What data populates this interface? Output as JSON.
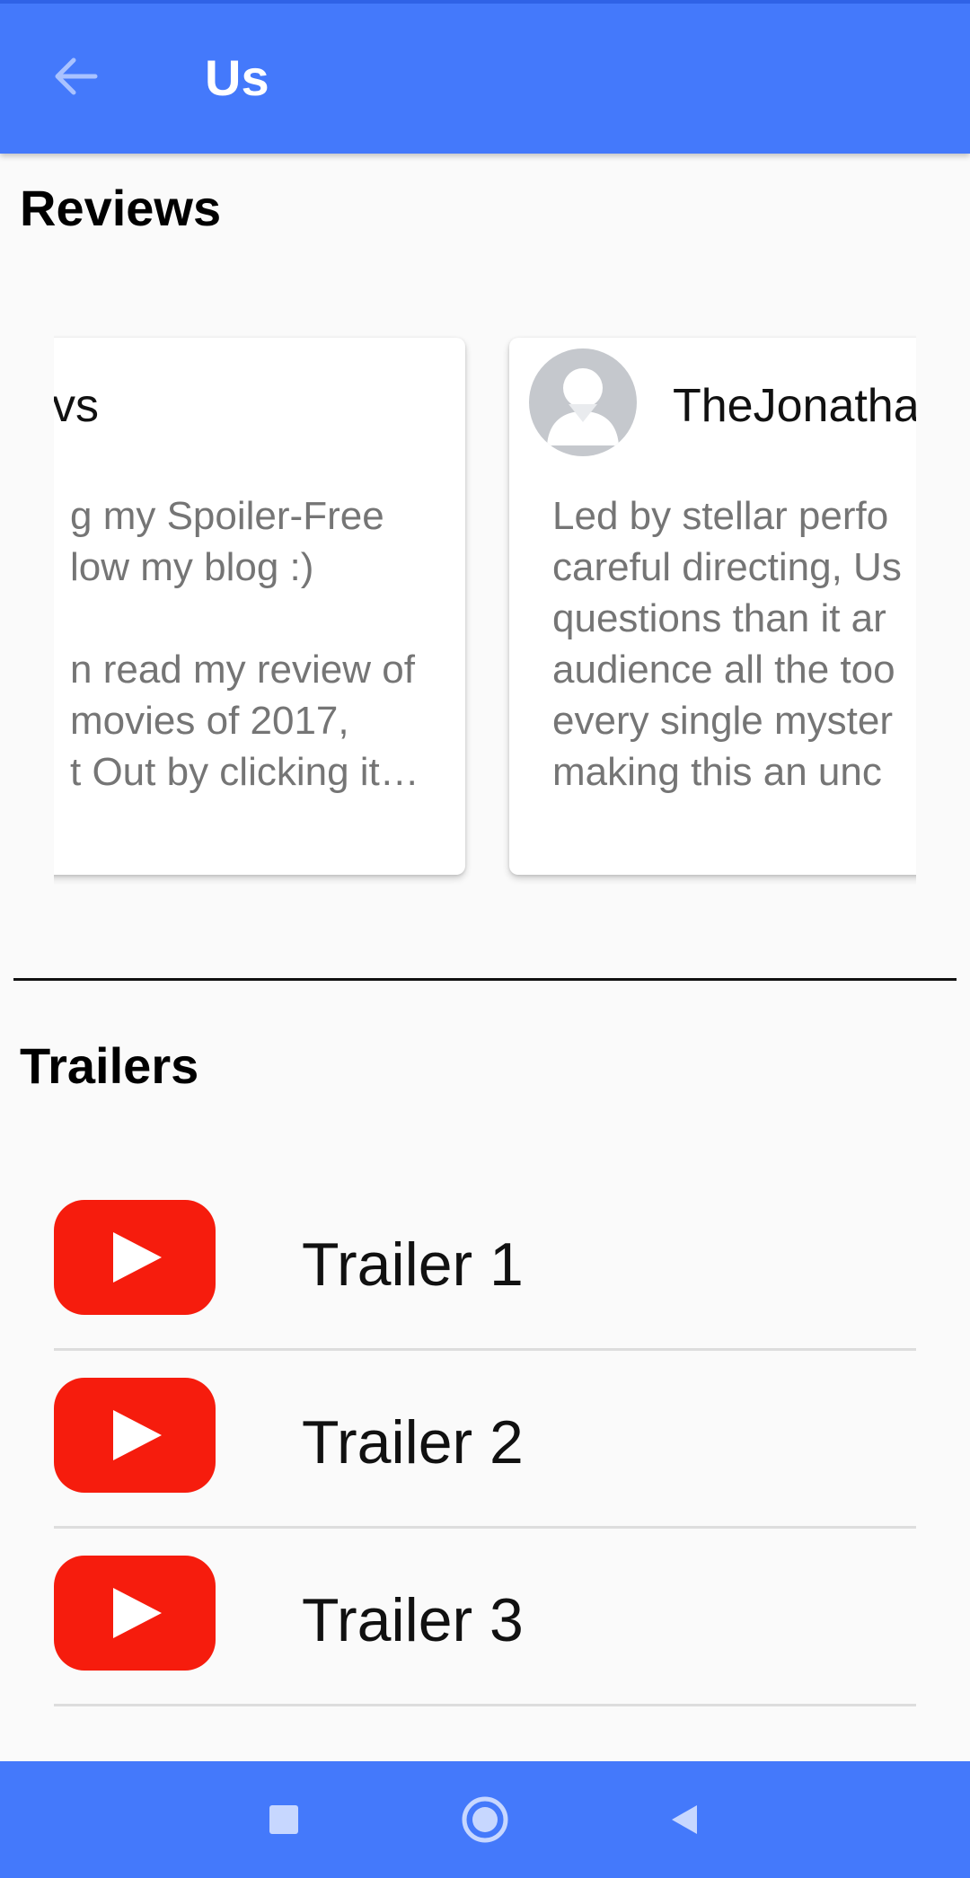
{
  "appbar": {
    "title": "Us",
    "back_icon": "arrow-left-icon",
    "color": "#4479fb"
  },
  "reviews": {
    "heading": "Reviews",
    "cards": [
      {
        "author": "vs",
        "paragraphs": [
          "g my Spoiler-Free\nlow my blog :)",
          "n read my review of\n movies of 2017,\nt Out by clicking it…"
        ]
      },
      {
        "author": "TheJonatha",
        "avatar_icon": "default-user-avatar-icon",
        "paragraphs": [
          "Led by stellar perfo\ncareful directing, Us\nquestions than it ar\naudience all the too\nevery single myster\nmaking this an unc"
        ]
      }
    ]
  },
  "trailers": {
    "heading": "Trailers",
    "items": [
      {
        "label": "Trailer 1",
        "icon": "youtube-play-icon"
      },
      {
        "label": "Trailer 2",
        "icon": "youtube-play-icon"
      },
      {
        "label": "Trailer 3",
        "icon": "youtube-play-icon"
      }
    ]
  },
  "navbar": {
    "buttons": [
      "recents-square-icon",
      "home-circle-icon",
      "back-triangle-icon"
    ]
  },
  "colors": {
    "accent": "#4479fb",
    "youtube_red": "#f61c0d",
    "muted_text": "#757575"
  }
}
